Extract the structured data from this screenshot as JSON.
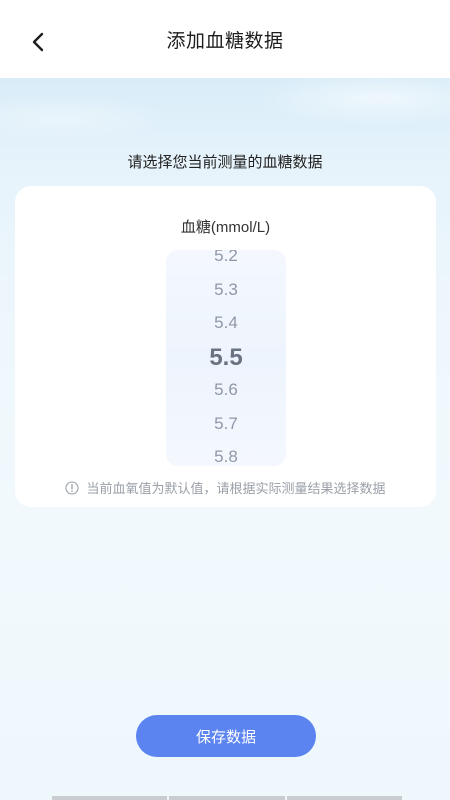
{
  "header": {
    "back_icon": "chevron-left-icon",
    "title": "添加血糖数据"
  },
  "prompt": "请选择您当前测量的血糖数据",
  "card": {
    "unit_label": "血糖(mmol/L)",
    "picker": {
      "items": [
        "5.2",
        "5.3",
        "5.4",
        "5.5",
        "5.6",
        "5.7",
        "5.8"
      ],
      "selected": "5.5"
    },
    "note_icon": "info-icon",
    "note": "当前血氧值为默认值，请根据实际测量结果选择数据"
  },
  "save_button": "保存数据",
  "colors": {
    "accent": "#5b84f1",
    "background": "#eef7fc"
  }
}
